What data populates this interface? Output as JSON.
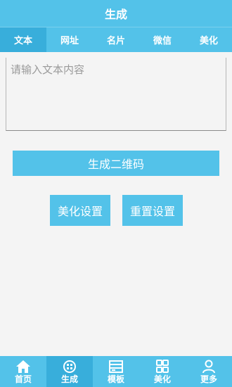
{
  "header": {
    "title": "生成"
  },
  "tabs": [
    {
      "label": "文本",
      "active": true
    },
    {
      "label": "网址",
      "active": false
    },
    {
      "label": "名片",
      "active": false
    },
    {
      "label": "微信",
      "active": false
    },
    {
      "label": "美化",
      "active": false
    }
  ],
  "input": {
    "placeholder": "请输入文本内容",
    "value": ""
  },
  "buttons": {
    "generate_label": "生成二维码",
    "beautify_label": "美化设置",
    "reset_label": "重置设置"
  },
  "bottom_nav": [
    {
      "label": "首页",
      "icon": "home-icon",
      "active": false
    },
    {
      "label": "生成",
      "icon": "generate-icon",
      "active": true
    },
    {
      "label": "模板",
      "icon": "template-icon",
      "active": false
    },
    {
      "label": "美化",
      "icon": "grid-icon",
      "active": false
    },
    {
      "label": "更多",
      "icon": "person-icon",
      "active": false
    }
  ],
  "colors": {
    "primary": "#53c2e9",
    "active": "#38aedb",
    "background": "#f4f4f4"
  }
}
